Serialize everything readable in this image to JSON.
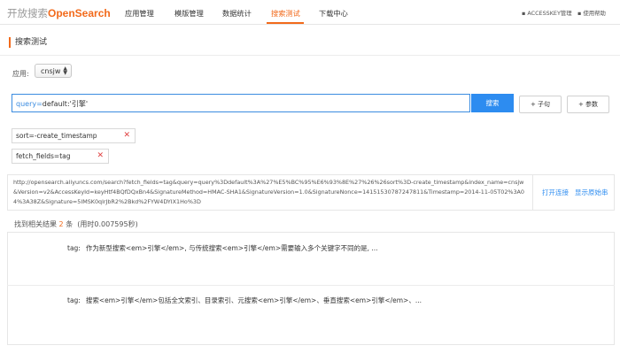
{
  "nav": {
    "logo_prefix": "开放搜索",
    "logo_brand": "OpenSearch",
    "items": [
      "应用管理",
      "模版管理",
      "数据统计",
      "搜索测试",
      "下载中心"
    ],
    "active_index": 3,
    "right_links": [
      "ACCESSKEY管理",
      "使用帮助"
    ],
    "accent": "#f26a1b"
  },
  "page": {
    "title": "搜索测试"
  },
  "app_select": {
    "label": "应用:",
    "value": "cnsjw"
  },
  "query": {
    "prefix": "query=",
    "value": "default:'引擎'",
    "search_label": "搜索",
    "clause_label": "+ 子句",
    "param_label": "+ 参数"
  },
  "params": [
    {
      "key": "sort=",
      "value": "-create_timestamp"
    },
    {
      "key": "fetch_fields=",
      "value": "tag"
    }
  ],
  "url": {
    "text": "http://opensearch.aliyuncs.com/search?fetch_fields=tag&query=query%3Ddefault%3A%27%E5%BC%95%E6%93%8E%27%26%26sort%3D-create_timestamp&index_name=cnsjw&Version=v2&AccessKeyId=keyHtf4BQfDQxBn4&SignatureMethod=HMAC-SHA1&SignatureVersion=1.0&SignatureNonce=14151530787247811&Timestamp=2014-11-05T02%3A04%3A38Z&Signature=5IMSK0qlrJbR2%2Bkd%2FYW4DYIX1Ho%3D",
    "open_link": "打开连接",
    "show_raw": "显示原始串"
  },
  "results": {
    "summary_prefix": "找到相关结果",
    "count": "2",
    "summary_unit": "条",
    "time": "(用时0.007595秒)",
    "rows": [
      {
        "key": "tag:",
        "value": "作为新型搜索<em>引擎</em>, 与传统搜索<em>引擎</em>需要输入多个关键字不同的是, ..."
      },
      {
        "key": "tag:",
        "value": "搜索<em>引擎</em>包括全文索引、目录索引、元搜索<em>引擎</em>、垂直搜索<em>引擎</em>、..."
      }
    ]
  }
}
